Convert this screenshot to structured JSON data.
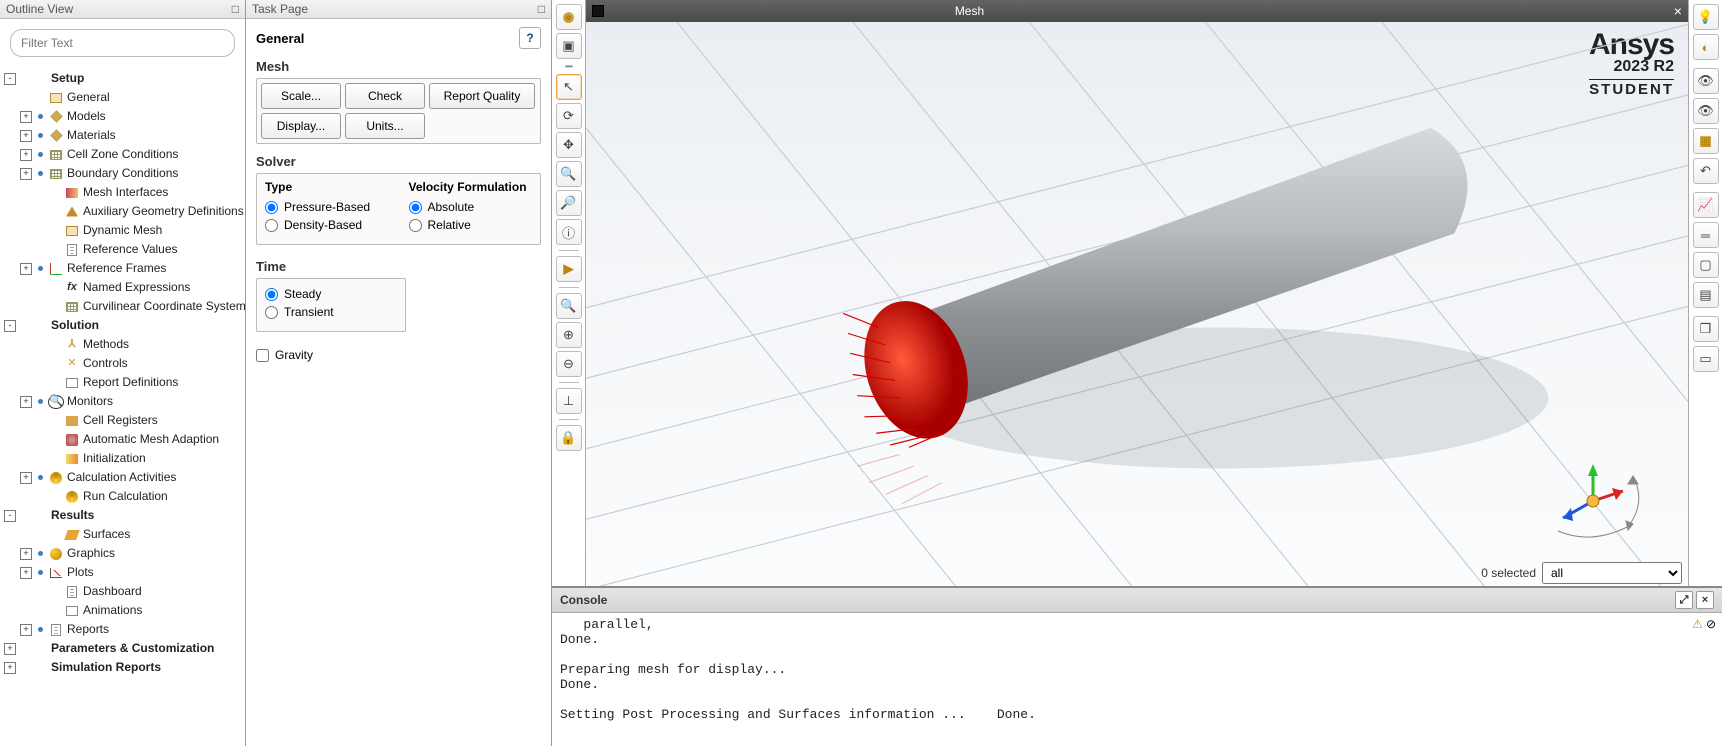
{
  "outline": {
    "header": "Outline View",
    "filter_placeholder": "Filter Text",
    "nodes": [
      {
        "indent": 0,
        "exp": "-",
        "dot": false,
        "icon": "",
        "bold": true,
        "label": "Setup"
      },
      {
        "indent": 1,
        "exp": "",
        "dot": false,
        "icon": "box",
        "bold": false,
        "label": "General"
      },
      {
        "indent": 1,
        "exp": "+",
        "dot": true,
        "icon": "cube",
        "bold": false,
        "label": "Models"
      },
      {
        "indent": 1,
        "exp": "+",
        "dot": true,
        "icon": "mat",
        "bold": false,
        "label": "Materials"
      },
      {
        "indent": 1,
        "exp": "+",
        "dot": true,
        "icon": "grid",
        "bold": false,
        "label": "Cell Zone Conditions"
      },
      {
        "indent": 1,
        "exp": "+",
        "dot": true,
        "icon": "grid",
        "bold": false,
        "label": "Boundary Conditions"
      },
      {
        "indent": 2,
        "exp": "",
        "dot": false,
        "icon": "interface",
        "bold": false,
        "label": "Mesh Interfaces"
      },
      {
        "indent": 2,
        "exp": "",
        "dot": false,
        "icon": "geom",
        "bold": false,
        "label": "Auxiliary Geometry Definitions"
      },
      {
        "indent": 2,
        "exp": "",
        "dot": false,
        "icon": "dyn",
        "bold": false,
        "label": "Dynamic Mesh"
      },
      {
        "indent": 2,
        "exp": "",
        "dot": false,
        "icon": "sheet",
        "bold": false,
        "label": "Reference Values"
      },
      {
        "indent": 1,
        "exp": "+",
        "dot": true,
        "icon": "axes",
        "bold": false,
        "label": "Reference Frames"
      },
      {
        "indent": 2,
        "exp": "",
        "dot": false,
        "icon": "fx",
        "bold": false,
        "label": "Named Expressions"
      },
      {
        "indent": 2,
        "exp": "",
        "dot": false,
        "icon": "grid",
        "bold": false,
        "label": "Curvilinear Coordinate System"
      },
      {
        "indent": 0,
        "exp": "-",
        "dot": false,
        "icon": "",
        "bold": true,
        "label": "Solution"
      },
      {
        "indent": 2,
        "exp": "",
        "dot": false,
        "icon": "y",
        "bold": false,
        "label": "Methods"
      },
      {
        "indent": 2,
        "exp": "",
        "dot": false,
        "icon": "y2",
        "bold": false,
        "label": "Controls"
      },
      {
        "indent": 2,
        "exp": "",
        "dot": false,
        "icon": "rep",
        "bold": false,
        "label": "Report Definitions"
      },
      {
        "indent": 1,
        "exp": "+",
        "dot": true,
        "icon": "q",
        "bold": false,
        "label": "Monitors"
      },
      {
        "indent": 2,
        "exp": "",
        "dot": false,
        "icon": "reg",
        "bold": false,
        "label": "Cell Registers"
      },
      {
        "indent": 2,
        "exp": "",
        "dot": false,
        "icon": "auto",
        "bold": false,
        "label": "Automatic Mesh Adaption"
      },
      {
        "indent": 2,
        "exp": "",
        "dot": false,
        "icon": "init",
        "bold": false,
        "label": "Initialization"
      },
      {
        "indent": 1,
        "exp": "+",
        "dot": true,
        "icon": "calc",
        "bold": false,
        "label": "Calculation Activities"
      },
      {
        "indent": 2,
        "exp": "",
        "dot": false,
        "icon": "calc",
        "bold": false,
        "label": "Run Calculation"
      },
      {
        "indent": 0,
        "exp": "-",
        "dot": false,
        "icon": "",
        "bold": true,
        "label": "Results"
      },
      {
        "indent": 2,
        "exp": "",
        "dot": false,
        "icon": "surf",
        "bold": false,
        "label": "Surfaces"
      },
      {
        "indent": 1,
        "exp": "+",
        "dot": true,
        "icon": "graph",
        "bold": false,
        "label": "Graphics"
      },
      {
        "indent": 1,
        "exp": "+",
        "dot": true,
        "icon": "plot",
        "bold": false,
        "label": "Plots"
      },
      {
        "indent": 2,
        "exp": "",
        "dot": false,
        "icon": "sheet",
        "bold": false,
        "label": "Dashboard"
      },
      {
        "indent": 2,
        "exp": "",
        "dot": false,
        "icon": "anim",
        "bold": false,
        "label": "Animations"
      },
      {
        "indent": 1,
        "exp": "+",
        "dot": true,
        "icon": "sheet",
        "bold": false,
        "label": "Reports"
      },
      {
        "indent": 0,
        "exp": "+",
        "dot": false,
        "icon": "",
        "bold": true,
        "label": "Parameters & Customization"
      },
      {
        "indent": 0,
        "exp": "+",
        "dot": false,
        "icon": "",
        "bold": true,
        "label": "Simulation Reports"
      }
    ]
  },
  "task": {
    "header": "Task Page",
    "title": "General",
    "help": "?",
    "mesh_label": "Mesh",
    "buttons": {
      "scale": "Scale...",
      "check": "Check",
      "report_quality": "Report Quality",
      "display": "Display...",
      "units": "Units..."
    },
    "solver_label": "Solver",
    "solver": {
      "type_label": "Type",
      "pressure": "Pressure-Based",
      "density": "Density-Based",
      "vel_label": "Velocity Formulation",
      "absolute": "Absolute",
      "relative": "Relative"
    },
    "time_label": "Time",
    "time": {
      "steady": "Steady",
      "transient": "Transient"
    },
    "gravity": "Gravity"
  },
  "viewport": {
    "tab_title": "Mesh",
    "close": "×",
    "selected_label": "0 selected",
    "select_value": "all",
    "brand": {
      "name": "Ansys",
      "version": "2023 R2",
      "edition": "STUDENT"
    }
  },
  "console": {
    "title": "Console",
    "text": "   parallel,\nDone.\n\nPreparing mesh for display...\nDone.\n\nSetting Post Processing and Surfaces information ...    Done."
  },
  "vtool_icons": [
    "globe",
    "cube",
    "cursor",
    "rotate",
    "pan",
    "zoom-box",
    "zoom",
    "info",
    "probe",
    "zoom-fit",
    "zoom-in",
    "zoom-out",
    "axes",
    "lock"
  ],
  "rtool_icons": [
    "lightbulb",
    "hide",
    "show",
    "box",
    "undo",
    "chart",
    "rule",
    "square",
    "overlay",
    "copy",
    "paste"
  ]
}
